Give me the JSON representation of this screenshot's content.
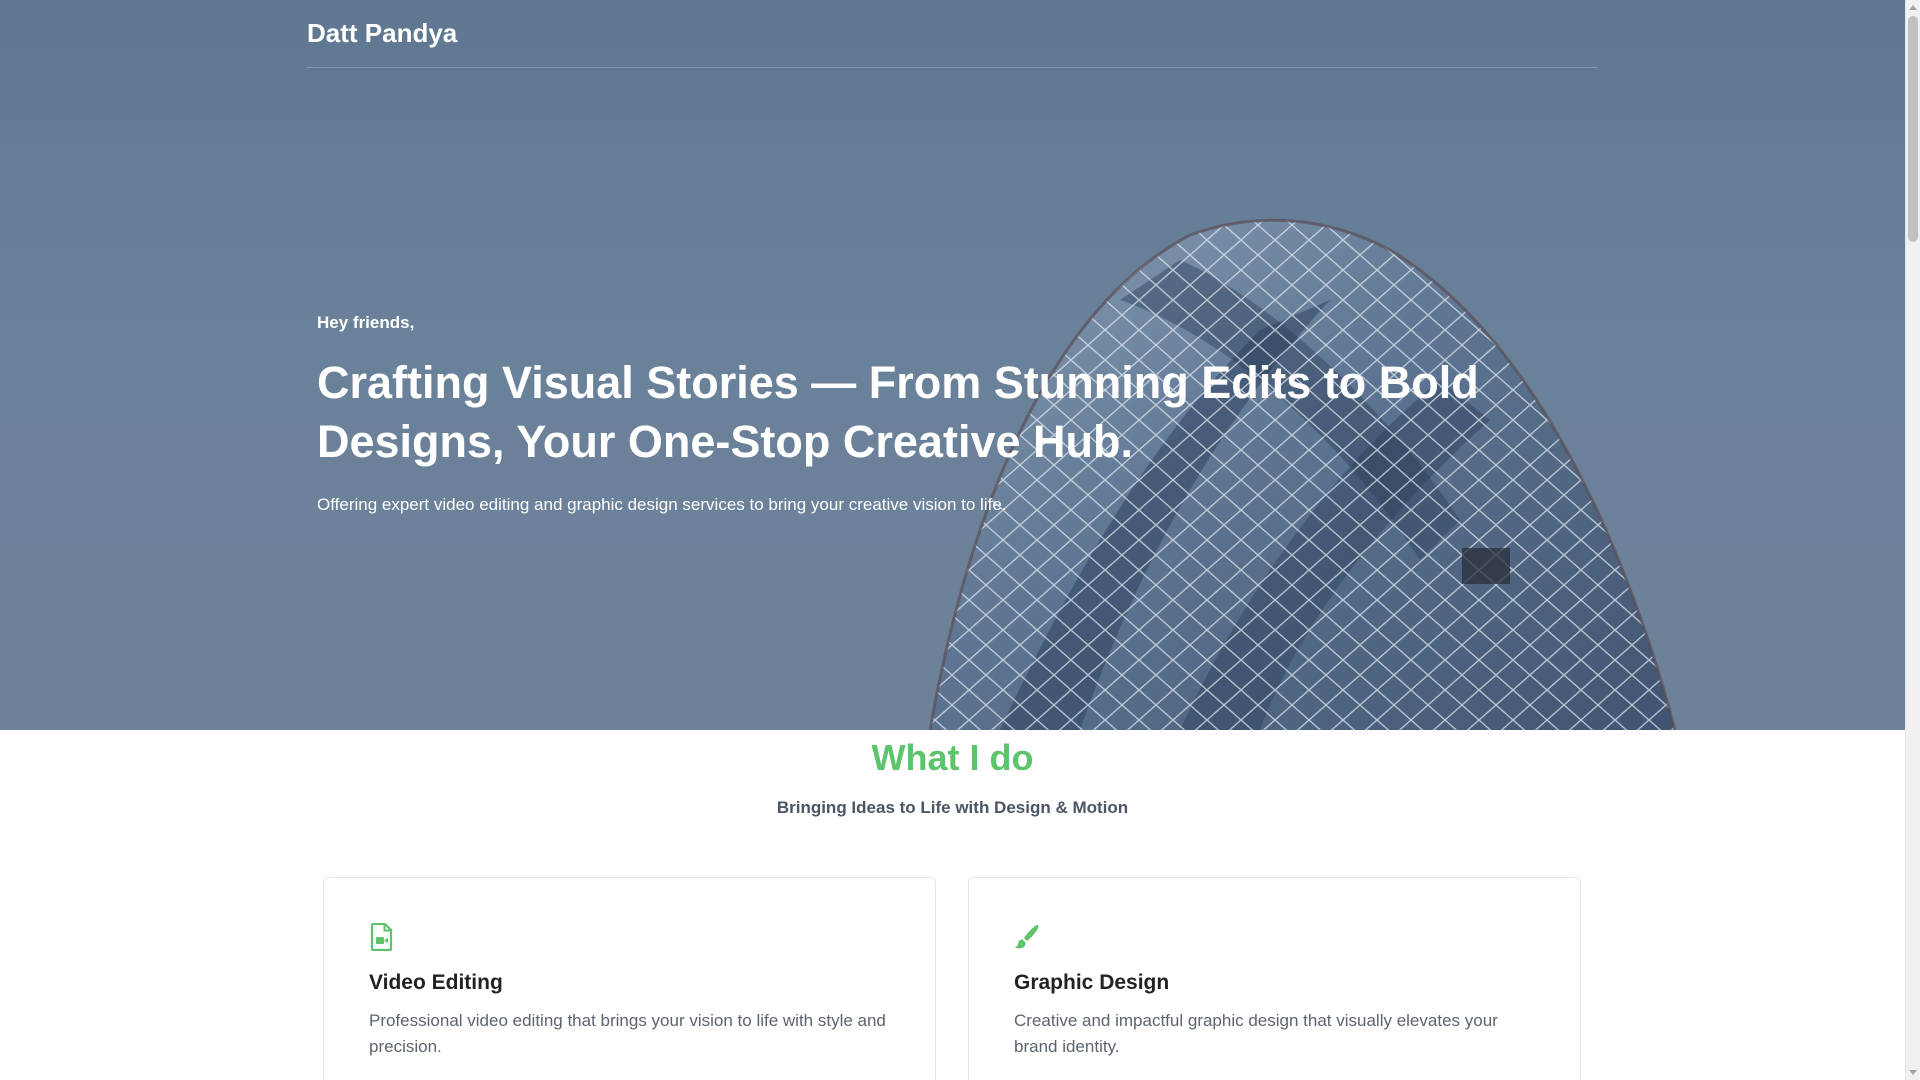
{
  "navbar": {
    "brand": "Datt Pandya"
  },
  "hero": {
    "greeting": "Hey friends,",
    "title": "Crafting Visual Stories — From Stunning Edits to Bold Designs, Your One-Stop Creative Hub.",
    "subtitle": "Offering expert video editing and graphic design services to bring your creative vision to life.",
    "background_image": "building-icon"
  },
  "services": {
    "title": "What I do",
    "subtitle": "Bringing Ideas to Life with Design & Motion",
    "accent_color": "#5cc46b",
    "cards": [
      {
        "icon": "video-file-icon",
        "title": "Video Editing",
        "text": "Professional video editing that brings your vision to life with style and precision."
      },
      {
        "icon": "paint-brush-icon",
        "title": "Graphic Design",
        "text": "Creative and impactful graphic design that visually elevates your brand identity."
      }
    ]
  }
}
